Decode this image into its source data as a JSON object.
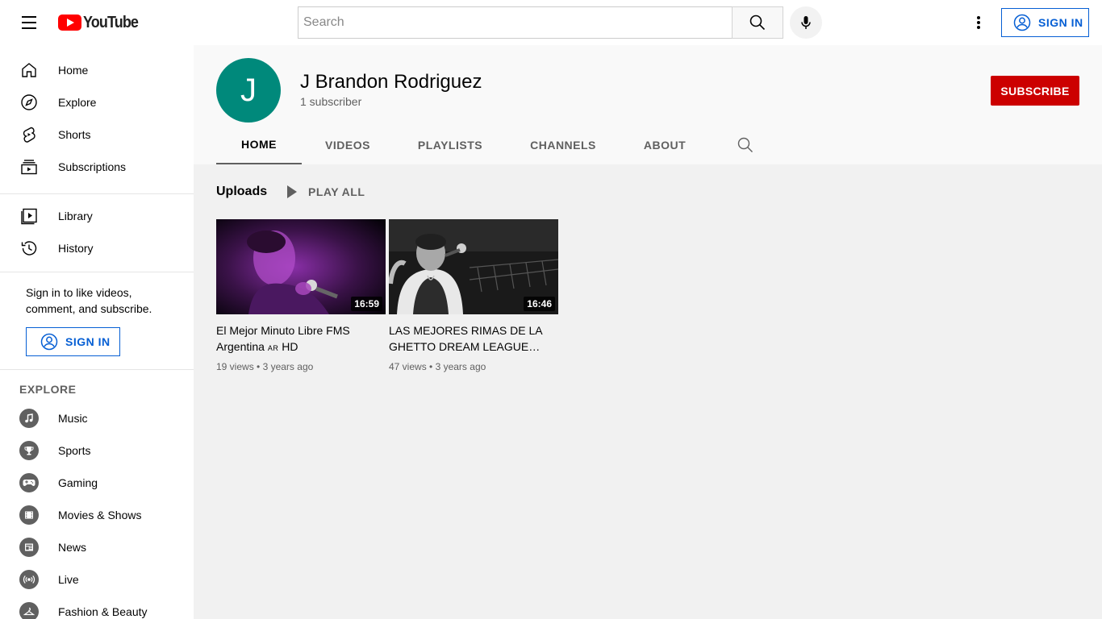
{
  "masthead": {
    "logo_text": "YouTube",
    "search_placeholder": "Search",
    "sign_in_label": "SIGN IN"
  },
  "sidebar": {
    "primary": [
      {
        "label": "Home",
        "icon": "home-icon"
      },
      {
        "label": "Explore",
        "icon": "compass-icon"
      },
      {
        "label": "Shorts",
        "icon": "shorts-icon"
      },
      {
        "label": "Subscriptions",
        "icon": "subscriptions-icon"
      }
    ],
    "secondary": [
      {
        "label": "Library",
        "icon": "library-icon"
      },
      {
        "label": "History",
        "icon": "history-icon"
      }
    ],
    "signin_prompt": "Sign in to like videos, comment, and subscribe.",
    "sign_in_label": "SIGN IN",
    "explore_heading": "EXPLORE",
    "explore": [
      {
        "label": "Music",
        "icon": "music-icon"
      },
      {
        "label": "Sports",
        "icon": "trophy-icon"
      },
      {
        "label": "Gaming",
        "icon": "gamepad-icon"
      },
      {
        "label": "Movies & Shows",
        "icon": "film-icon"
      },
      {
        "label": "News",
        "icon": "news-icon"
      },
      {
        "label": "Live",
        "icon": "live-icon"
      },
      {
        "label": "Fashion & Beauty",
        "icon": "hanger-icon"
      }
    ]
  },
  "channel": {
    "avatar_letter": "J",
    "avatar_color": "#00897b",
    "name": "J Brandon Rodriguez",
    "subscribers": "1 subscriber",
    "subscribe_label": "SUBSCRIBE",
    "tabs": [
      "HOME",
      "VIDEOS",
      "PLAYLISTS",
      "CHANNELS",
      "ABOUT"
    ],
    "active_tab": "HOME"
  },
  "uploads": {
    "title": "Uploads",
    "play_all_label": "PLAY ALL",
    "videos": [
      {
        "title_line1": "El Mejor Minuto Libre FMS",
        "title_line2a": "Argentina",
        "title_flag": "AR",
        "title_line2b": "HD",
        "duration": "16:59",
        "views": "19 views",
        "age": "3 years ago"
      },
      {
        "title": "LAS MEJORES RIMAS DE LA GHETTO DREAM LEAGUE…",
        "duration": "16:46",
        "views": "47 views",
        "age": "3 years ago"
      }
    ]
  },
  "colors": {
    "brand_red": "#ff0000",
    "subscribe_red": "#cc0000",
    "link_blue": "#065fd4"
  }
}
